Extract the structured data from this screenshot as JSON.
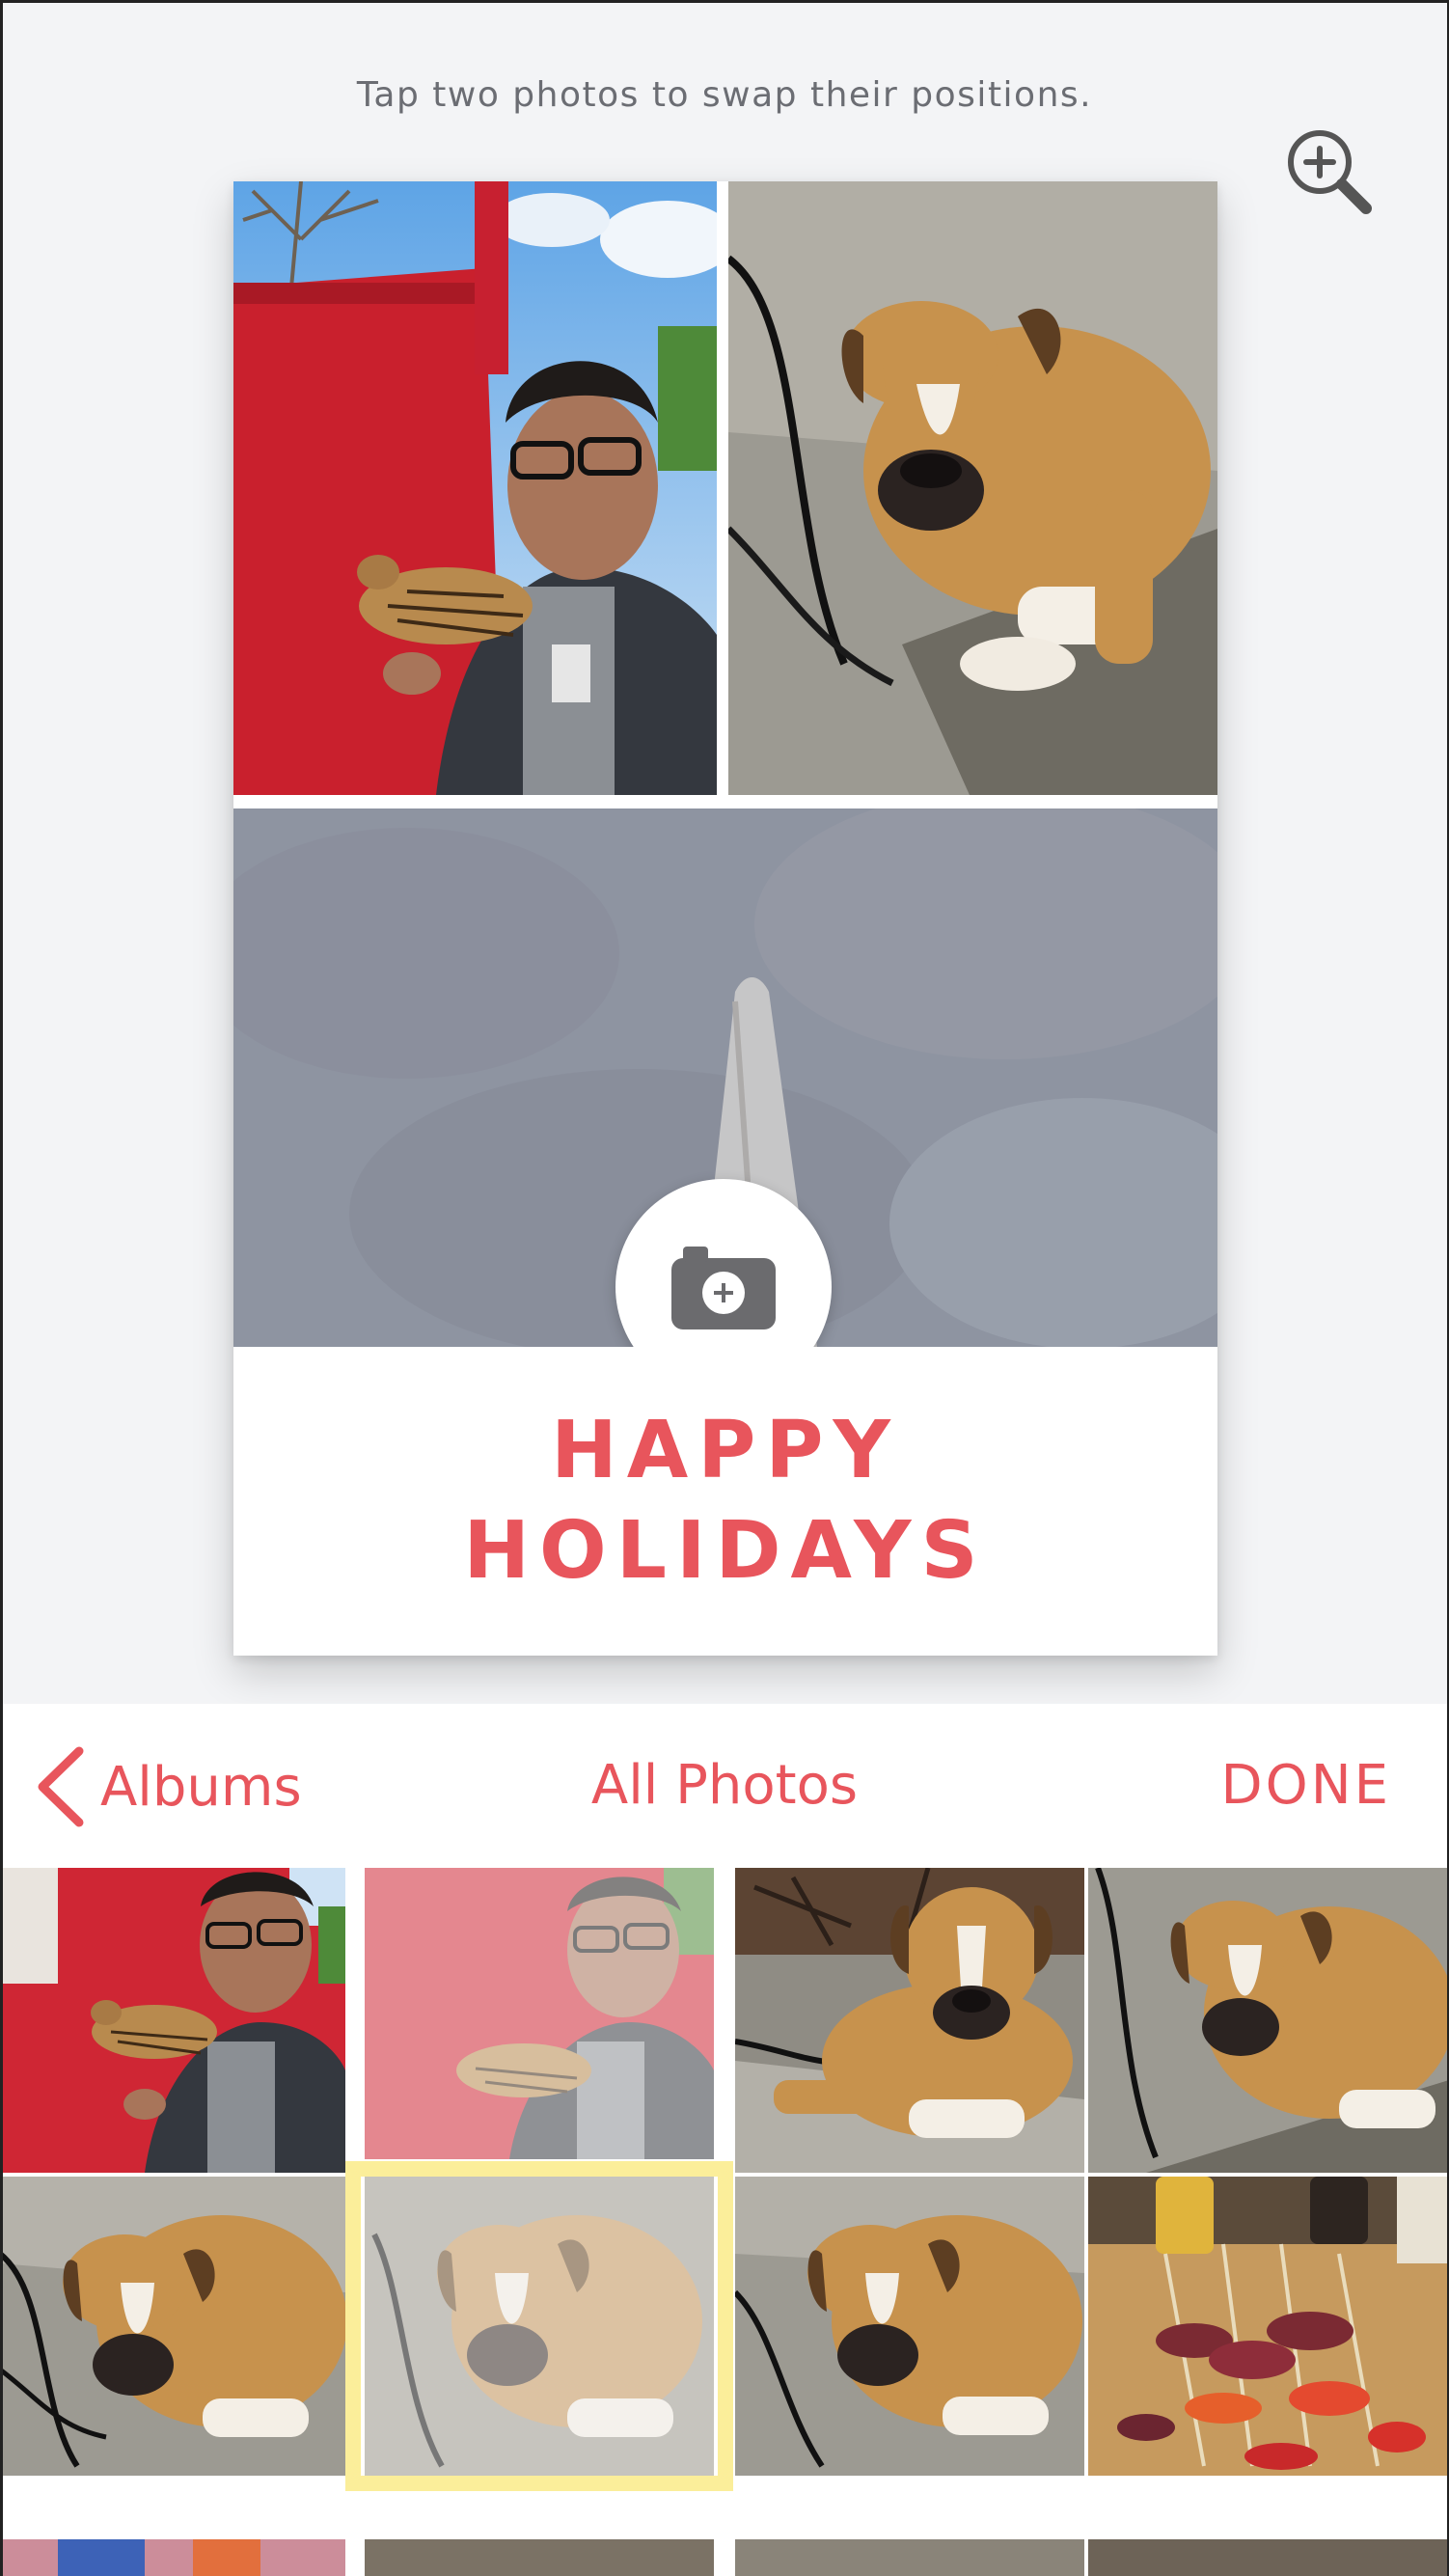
{
  "hint_text": "Tap two photos to swap their positions.",
  "card": {
    "greeting_line1": "HAPPY",
    "greeting_line2": "HOLIDAYS",
    "accent_color": "#e8555c"
  },
  "icons": {
    "zoom": "zoom-in-icon",
    "add_photo": "camera-plus-icon",
    "back": "chevron-left-icon"
  },
  "picker": {
    "back_label": "Albums",
    "title": "All Photos",
    "done_label": "DONE"
  },
  "grid": {
    "selected_index": 5,
    "used_index": 1,
    "highlight_color": "#fbee9a",
    "thumbnails": [
      "man-with-chicken",
      "man-with-chicken",
      "dog",
      "dog",
      "dog",
      "dog",
      "dog",
      "grilled-skewers"
    ]
  }
}
